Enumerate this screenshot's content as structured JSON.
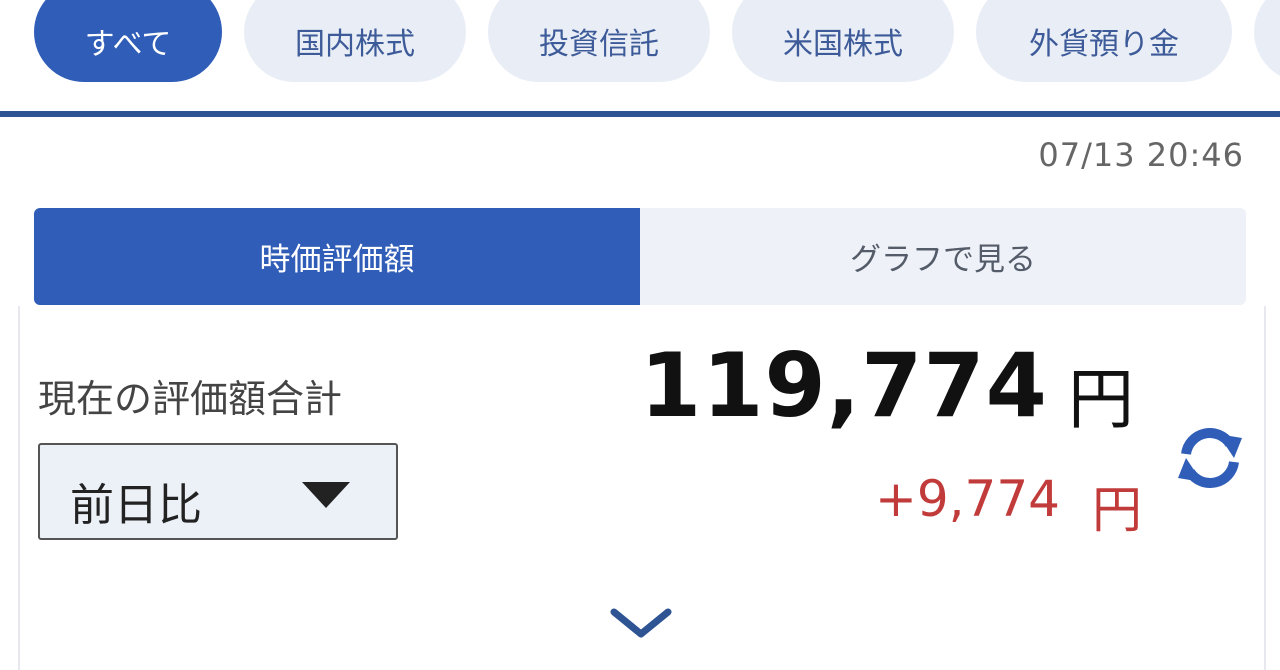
{
  "category_tabs": [
    {
      "label": "すべて",
      "active": true
    },
    {
      "label": "国内株式",
      "active": false
    },
    {
      "label": "投資信託",
      "active": false
    },
    {
      "label": "米国株式",
      "active": false
    },
    {
      "label": "外貨預り金",
      "active": false
    }
  ],
  "timestamp": "07/13 20:46",
  "view_tabs": [
    {
      "label": "時価評価額",
      "active": true
    },
    {
      "label": "グラフで見る",
      "active": false
    }
  ],
  "summary": {
    "label": "現在の評価額合計",
    "total_value": "119,774",
    "total_unit": "円",
    "compare_select": {
      "selected": "前日比"
    },
    "diff_value": "+9,774",
    "diff_unit": "円"
  },
  "icons": {
    "refresh": "refresh-icon",
    "expand": "chevron-down-icon",
    "dropdown": "triangle-down-icon"
  },
  "colors": {
    "accent": "#2f5db7",
    "pill_bg": "#e9eef6",
    "positive": "#c23b3b"
  }
}
